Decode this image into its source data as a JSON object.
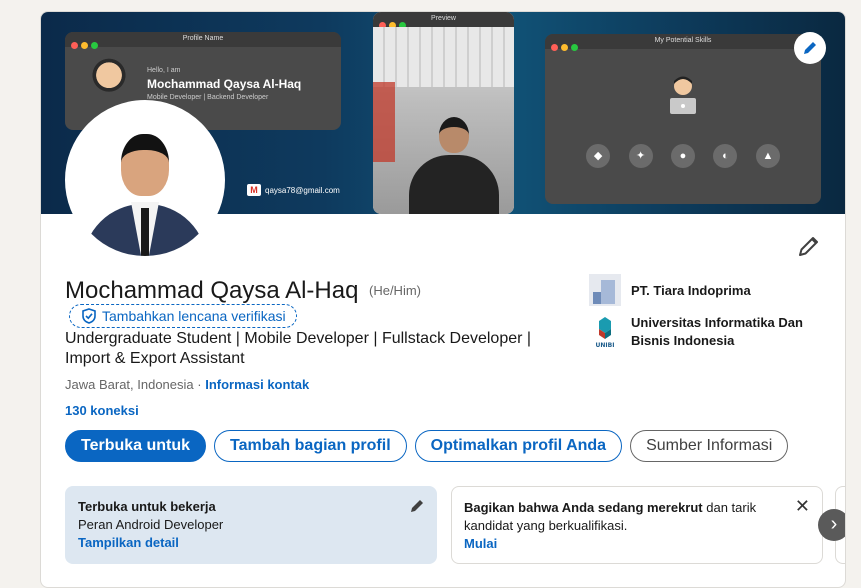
{
  "banner": {
    "window1_title": "Profile Name",
    "hello_text": "Hello, I am",
    "banner_name": "Mochammad Qaysa Al-Haq",
    "banner_role": "Mobile Developer | Backend Developer",
    "email": "qaysa78@gmail.com",
    "window2_title": "Preview",
    "window3_title": "My Potential Skills",
    "skill_icons": [
      "flutter-icon",
      "android-studio-icon",
      "apple-icon",
      "kotlin-icon",
      "laravel-icon"
    ]
  },
  "profile": {
    "name": "Mochammad Qaysa Al-Haq",
    "pronouns": "(He/Him)",
    "verify_label": "Tambahkan lencana verifikasi",
    "headline": "Undergraduate Student | Mobile Developer | Fullstack Developer | Import & Export Assistant",
    "location": "Jawa Barat, Indonesia",
    "location_sep": " · ",
    "contact_info": "Informasi kontak",
    "connections": "130 koneksi"
  },
  "organizations": [
    {
      "name": "PT. Tiara Indoprima"
    },
    {
      "name": "Universitas Informatika Dan Bisnis Indonesia"
    }
  ],
  "actions": {
    "open_to": "Terbuka untuk",
    "add_section": "Tambah bagian profil",
    "optimize": "Optimalkan profil Anda",
    "resources": "Sumber Informasi"
  },
  "panels": {
    "open_to_work_title": "Terbuka untuk bekerja",
    "open_to_work_role": "Peran Android Developer",
    "open_to_work_link": "Tampilkan detail",
    "hiring_bold": "Bagikan bahwa Anda sedang merekrut",
    "hiring_rest": " dan tarik kandidat yang berkualifikasi.",
    "hiring_link": "Mulai",
    "close_symbol": "✕",
    "next_symbol": "›"
  },
  "colors": {
    "accent": "#0a66c2",
    "panel_bg": "#dde7f1"
  }
}
